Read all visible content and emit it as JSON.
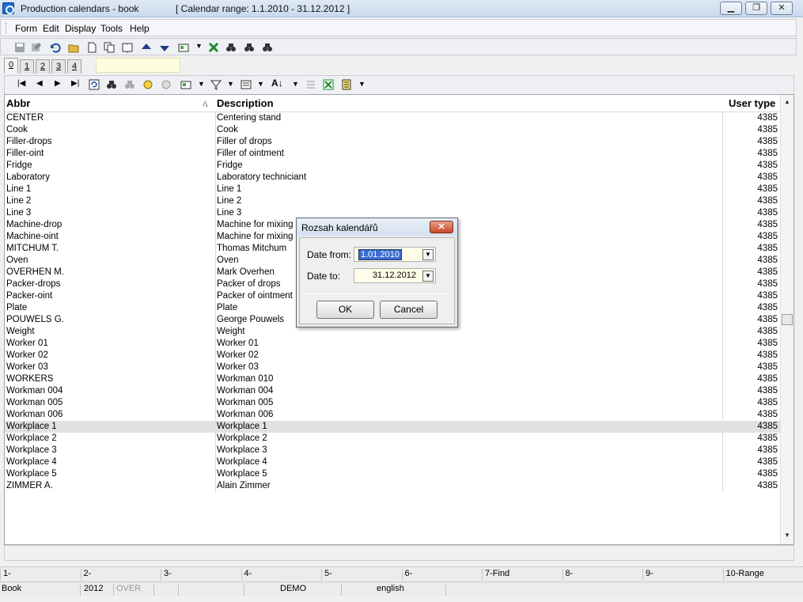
{
  "window": {
    "title": "Production calendars - book",
    "range_text": "[ Calendar range: 1.1.2010 - 31.12.2012 ]"
  },
  "menu": [
    "Form",
    "Edit",
    "Display",
    "Tools",
    "Help"
  ],
  "tabs": [
    "0",
    "1",
    "2",
    "3",
    "4"
  ],
  "grid": {
    "columns": {
      "abbr": "Abbr",
      "sort_mark": "⁄₁",
      "description": "Description",
      "user_type": "User type"
    },
    "rows": [
      {
        "abbr": "CENTER",
        "desc": "Centering stand",
        "type": "4385"
      },
      {
        "abbr": "Cook",
        "desc": "Cook",
        "type": "4385"
      },
      {
        "abbr": "Filler-drops",
        "desc": "Filler of drops",
        "type": "4385"
      },
      {
        "abbr": "Filler-oint",
        "desc": "Filler of ointment",
        "type": "4385"
      },
      {
        "abbr": "Fridge",
        "desc": "Fridge",
        "type": "4385"
      },
      {
        "abbr": "Laboratory",
        "desc": "Laboratory techniciant",
        "type": "4385"
      },
      {
        "abbr": "Line 1",
        "desc": "Line 1",
        "type": "4385"
      },
      {
        "abbr": "Line 2",
        "desc": "Line 2",
        "type": "4385"
      },
      {
        "abbr": "Line 3",
        "desc": "Line 3",
        "type": "4385"
      },
      {
        "abbr": "Machine-drop",
        "desc": "Machine for mixing dr",
        "type": "4385"
      },
      {
        "abbr": "Machine-oint",
        "desc": "Machine for mixing oi",
        "type": "4385"
      },
      {
        "abbr": "MITCHUM T.",
        "desc": "Thomas Mitchum",
        "type": "4385"
      },
      {
        "abbr": "Oven",
        "desc": "Oven",
        "type": "4385"
      },
      {
        "abbr": "OVERHEN M.",
        "desc": "Mark Overhen",
        "type": "4385"
      },
      {
        "abbr": "Packer-drops",
        "desc": "Packer of drops",
        "type": "4385"
      },
      {
        "abbr": "Packer-oint",
        "desc": "Packer of ointment",
        "type": "4385"
      },
      {
        "abbr": "Plate",
        "desc": "Plate",
        "type": "4385"
      },
      {
        "abbr": "POUWELS G.",
        "desc": "George Pouwels",
        "type": "4385"
      },
      {
        "abbr": "Weight",
        "desc": "Weight",
        "type": "4385"
      },
      {
        "abbr": "Worker 01",
        "desc": "Worker 01",
        "type": "4385"
      },
      {
        "abbr": "Worker 02",
        "desc": "Worker 02",
        "type": "4385"
      },
      {
        "abbr": "Worker 03",
        "desc": "Worker 03",
        "type": "4385"
      },
      {
        "abbr": "WORKERS",
        "desc": "Workman 010",
        "type": "4385"
      },
      {
        "abbr": "Workman 004",
        "desc": "Workman 004",
        "type": "4385"
      },
      {
        "abbr": "Workman 005",
        "desc": "Workman 005",
        "type": "4385"
      },
      {
        "abbr": "Workman 006",
        "desc": "Workman 006",
        "type": "4385"
      },
      {
        "abbr": "Workplace 1",
        "desc": "Workplace 1",
        "type": "4385"
      },
      {
        "abbr": "Workplace 2",
        "desc": "Workplace 2",
        "type": "4385"
      },
      {
        "abbr": "Workplace 3",
        "desc": "Workplace 3",
        "type": "4385"
      },
      {
        "abbr": "Workplace 4",
        "desc": "Workplace 4",
        "type": "4385"
      },
      {
        "abbr": "Workplace 5",
        "desc": "Workplace 5",
        "type": "4385"
      },
      {
        "abbr": "ZIMMER A.",
        "desc": "Alain Zimmer",
        "type": "4385"
      }
    ],
    "selected_row_abbr": "Workplace 1"
  },
  "dialog": {
    "title": "Rozsah kalendářů",
    "close_glyph": "✕",
    "date_from_label": "Date from:",
    "date_from_value": "1.01.2010",
    "date_to_label": "Date to:",
    "date_to_value": "31.12.2012",
    "ok_label": "OK",
    "cancel_label": "Cancel"
  },
  "fkeys": [
    "1-",
    "2-",
    "3-",
    "4-",
    "5-",
    "6-",
    "7-Find",
    "8-",
    "9-",
    "10-Range"
  ],
  "status": {
    "book": "Book",
    "year": "2012",
    "over": "OVER",
    "demo": "DEMO",
    "language": "english"
  },
  "colors": {
    "selection": "#e2e2e2",
    "input_bg": "#fffde8",
    "selected_text_bg": "#3b6dd1"
  }
}
